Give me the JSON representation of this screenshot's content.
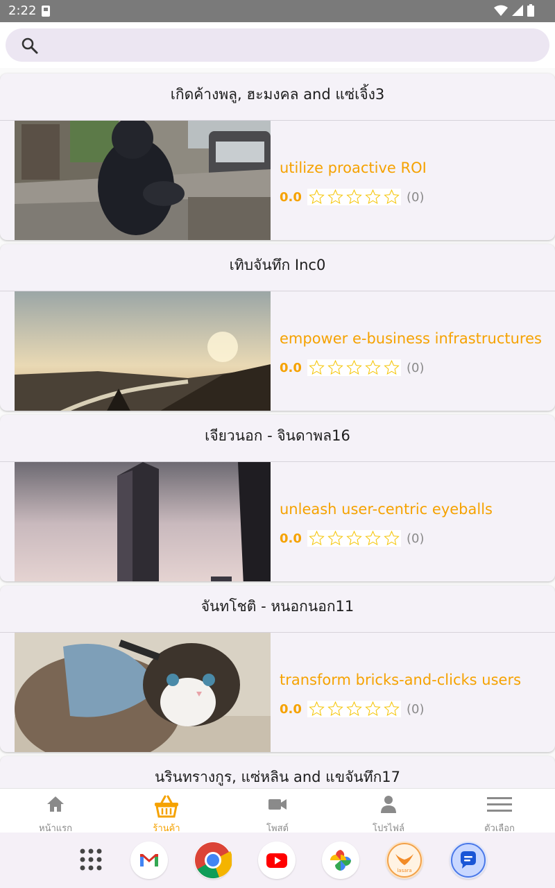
{
  "status_bar": {
    "time": "2:22"
  },
  "search": {
    "placeholder": ""
  },
  "stores": [
    {
      "store_name": "เกิดค้างพลู, ฮะมงคล and แซ่เจิ้ง3",
      "product_title": "utilize proactive ROI",
      "score": "0.0",
      "review_count": "(0)",
      "stars": 0,
      "image": "bear-statue-photo"
    },
    {
      "store_name": "เทิบจันทึก Inc0",
      "product_title": "empower e-business infrastructures",
      "score": "0.0",
      "review_count": "(0)",
      "stars": 0,
      "image": "sunset-valley-photo"
    },
    {
      "store_name": "เจียวนอก - จินดาพล16",
      "product_title": "unleash user-centric eyeballs",
      "score": "0.0",
      "review_count": "(0)",
      "stars": 0,
      "image": "skyscraper-photo"
    },
    {
      "store_name": "จันทโชติ - หนอกนอก11",
      "product_title": "transform bricks-and-clicks users",
      "score": "0.0",
      "review_count": "(0)",
      "stars": 0,
      "image": "cat-harness-photo"
    },
    {
      "store_name": "นรินทรางกูร, แซ่หลิน and แขจันทึก17"
    }
  ],
  "bottom_nav": [
    {
      "label": "หน้าแรก",
      "icon": "home-icon",
      "active": false
    },
    {
      "label": "ร้านค้า",
      "icon": "basket-icon",
      "active": true
    },
    {
      "label": "โพสต์",
      "icon": "video-icon",
      "active": false
    },
    {
      "label": "โปรไฟล์",
      "icon": "person-icon",
      "active": false
    },
    {
      "label": "ตัวเลือก",
      "icon": "menu-icon",
      "active": false
    }
  ],
  "dock": {
    "apps": [
      "app-drawer-icon",
      "gmail-icon",
      "chrome-icon",
      "youtube-icon",
      "photos-icon",
      "lasara-icon",
      "messages-icon"
    ],
    "lasara_label": "lasara"
  },
  "colors": {
    "accent": "#f5a200",
    "inactive": "#8a8a8a",
    "card_bg": "#f5f2f8",
    "search_bg": "#ece6f2"
  }
}
